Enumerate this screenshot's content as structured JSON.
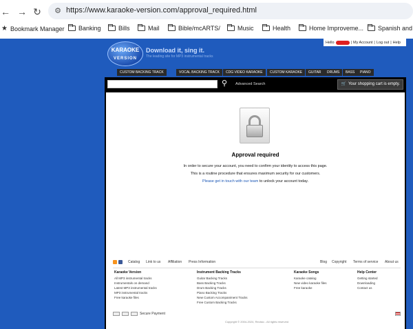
{
  "browser": {
    "url": "https://www.karaoke-version.com/approval_required.html",
    "bookmarks": [
      "Bookmark Manager",
      "Banking",
      "Bills",
      "Mail",
      "Bible/mcARTS/",
      "Music",
      "Health",
      "Home Improveme...",
      "Spanish and e"
    ]
  },
  "header": {
    "logo_line1": "KARAOKE",
    "logo_line2": "VERSION",
    "tagline": "Download it, sing it.",
    "tagline_sub": "The leading site for MP3 instrumental tracks",
    "account": {
      "hello": "Hello",
      "my_account": "My Account",
      "logout": "Log out",
      "help": "Help",
      "sep": "|"
    },
    "menu": [
      "Custom Backing Track",
      "Vocal Backing Track",
      "CDG Video Karaoke",
      "Custom Karaoke",
      "Guitar",
      "Drums",
      "Bass",
      "Piano"
    ]
  },
  "toolbar": {
    "search_placeholder": "",
    "advanced_search": "Advanced Search",
    "cart": "Your shopping cart is empty."
  },
  "main": {
    "title": "Approval required",
    "line1": "In order to secure your account, you need to confirm your identity to access this page.",
    "line2": "This is a routine procedure that ensures maximum security for our customers.",
    "contact_link": "Please get in touch with our team",
    "line3_suffix": "to unlock your account today."
  },
  "footer": {
    "links_left": [
      "Catalog",
      "Link to us",
      "Affiliation",
      "Press Information"
    ],
    "links_right": [
      "Blog",
      "Copyright",
      "Terms of service",
      "About us"
    ],
    "col1": {
      "title": "Karaoke Version",
      "items": [
        "All MP3 instrumental tracks",
        "Instrumentals on demand",
        "Latest MP3 instrumental tracks",
        "MP3 instrumental tracks",
        "Free karaoke files"
      ]
    },
    "col2": {
      "title": "Instrument Backing Tracks",
      "items": [
        "Guitar Backing Tracks",
        "Bass Backing Tracks",
        "Drum Backing Tracks",
        "Piano Backing Tracks",
        "New Custom Accompaniment Tracks",
        "Free Custom Backing Tracks"
      ]
    },
    "col3": {
      "title": "Karaoke Songs",
      "items": [
        "Karaoke catalog",
        "New video karaoke files",
        "Free karaoke"
      ]
    },
    "col4": {
      "title": "Help Center",
      "items": [
        "Getting started",
        "Downloading",
        "Contact us"
      ]
    },
    "secure": "Secure Payment",
    "copyright": "Copyright © 2004-2024, Recisio - All rights reserved"
  }
}
